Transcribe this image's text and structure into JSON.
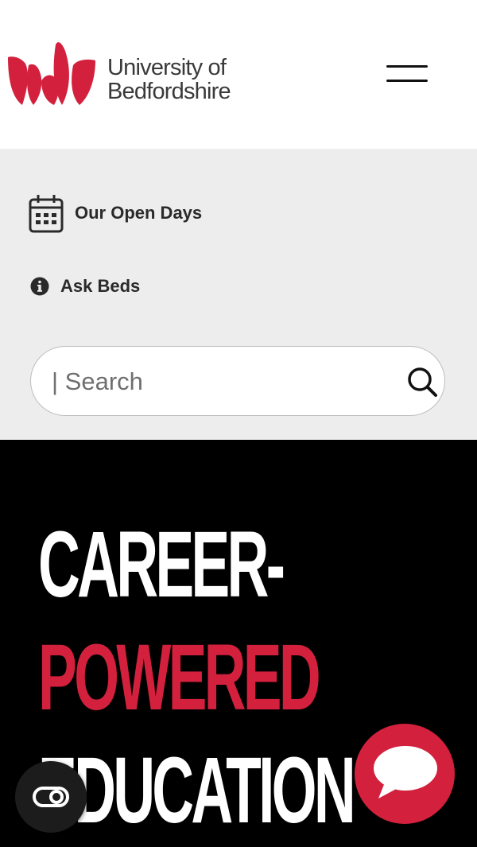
{
  "header": {
    "logo_line1": "University of",
    "logo_line2": "Bedfordshire",
    "brand_color": "#d3213d",
    "menu_icon": "hamburger-menu-icon"
  },
  "utility_links": {
    "open_days": {
      "label": "Our Open Days",
      "icon": "calendar-icon"
    },
    "ask_beds": {
      "label": "Ask Beds",
      "icon": "info-icon"
    }
  },
  "search": {
    "placeholder": "| Search",
    "icon": "search-icon"
  },
  "hero": {
    "line1": "CAREER-",
    "line2": "POWERED",
    "line3": "EDUCATION",
    "accent_color": "#d3213d"
  },
  "floating_buttons": {
    "left_icon": "accessibility-toggle-icon",
    "right_icon": "chat-bubble-icon"
  }
}
